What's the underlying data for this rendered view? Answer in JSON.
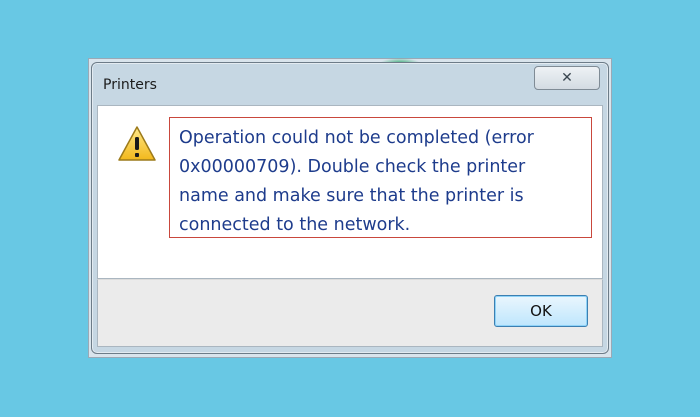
{
  "dialog": {
    "title": "Printers",
    "close_glyph": "✕",
    "icon": "warning-icon",
    "message": "Operation could not be completed (error\n0x00000709). Double check the printer\nname and make sure that the printer is\nconnected to the network.",
    "ok_label": "OK"
  },
  "colors": {
    "background": "#68c8e4",
    "message_text": "#1e3c8c",
    "highlight_border": "#c9473c"
  }
}
